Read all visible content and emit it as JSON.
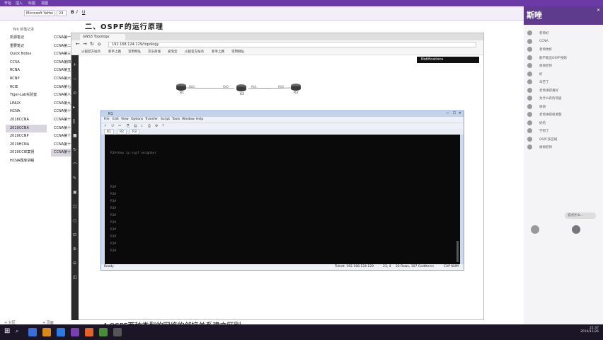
{
  "app": {
    "ribbon_tabs": [
      "开始",
      "插入",
      "绘图",
      "视图"
    ],
    "font_name": "Microsoft YaHei",
    "font_size": "24",
    "heading_top": "二、OSPF的运行原理"
  },
  "sidebar": {
    "header": "Yeti 的笔记本",
    "notebooks": [
      "凯源笔记",
      "重要笔记",
      "Quick Notes",
      "CCSA",
      "RCNA",
      "RCNP",
      "RCIE",
      "Tiger-Lab实验室",
      "LINUX",
      "HCNA",
      "2018CCNA",
      "2019CCNA",
      "2019CCNP",
      "2019HCNA",
      "2019CCIE案例",
      "HCNA题库讲解"
    ],
    "pages": [
      "CCNA第一",
      "CCNA第二",
      "CCNA第三",
      "CCNA第四",
      "CCNA第五",
      "CCNA第六",
      "CCNA第七",
      "CCNA第八",
      "CCNA第九",
      "CCNA第十",
      "CCNA第十",
      "CCNA第十",
      "CCNA第十",
      "CCNA第十",
      "CCNA第十"
    ],
    "add_section": "+ 分区",
    "add_page": "+ 页面"
  },
  "browser": {
    "tab_title": "GNS3 Topology",
    "address": "192.168.124.129/topology",
    "bookmarks": [
      "火狐官方站点",
      "新手上路",
      "常用网址",
      "京东商城",
      "爱淘宝",
      "火狐官方站点",
      "新手上路",
      "常用网址"
    ],
    "notifications": "Notifications",
    "routers": [
      "R1",
      "R2",
      "R3"
    ],
    "links": [
      "f0/0",
      "f0/0",
      "f0/1",
      "f0/0"
    ]
  },
  "crt": {
    "title": "R1",
    "menu": [
      "File",
      "Edit",
      "View",
      "Options",
      "Transfer",
      "Script",
      "Tools",
      "Window",
      "Help"
    ],
    "tabs": [
      "R1",
      "R2",
      "R3"
    ],
    "terminal_lines": [
      "R1#show ip ospf neighbor",
      "R1#",
      "R1#",
      "R1#",
      "R1#",
      "R1#",
      "R1#",
      "R1#",
      "R1#",
      "R1#",
      "R1#"
    ],
    "status_ready": "Ready",
    "status_conn": "Telnet: 192.168.124.129",
    "status_pos": "23,  4",
    "status_size": "22 Rows, 107 Cols",
    "status_term": "Xterm",
    "status_caps": "CAP  NUM"
  },
  "subtitle": "4.OSPF两种类型的网络的邻接关系建立区别",
  "right_panel": {
    "header": "斯唑",
    "messages": [
      "老师好",
      "CCNA",
      "老师你好",
      "能不能出OSPF视频",
      "谢谢老师",
      "好",
      "辛苦了",
      "老师讲得真好",
      "为什么有的邻居",
      "谢谢",
      "老师讲得很清楚",
      "好的",
      "学到了",
      "OSPF多区域",
      "谢谢老师"
    ],
    "input_placeholder": "说点什么..."
  },
  "taskbar": {
    "time": "21:47",
    "date": "2019/11/26"
  }
}
